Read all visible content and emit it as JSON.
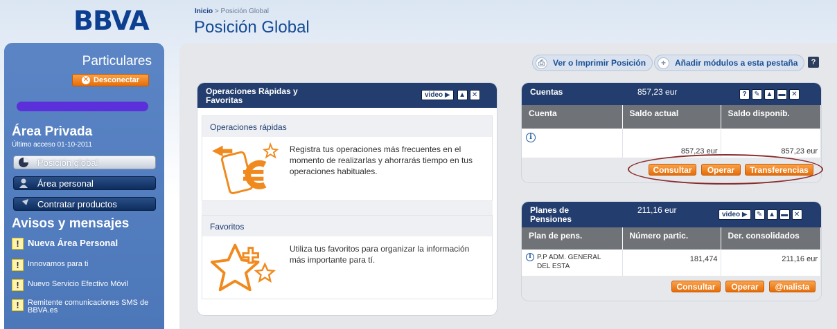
{
  "brand": {
    "logo": "BBVA",
    "accent_orange": "#e66d08",
    "navy": "#233e6e"
  },
  "header": {
    "breadcrumb_home": "Inicio",
    "breadcrumb_sep": " > ",
    "breadcrumb_current": "Posición Global",
    "title": "Posición Global"
  },
  "sidebar": {
    "title": "Particulares",
    "disconnect_label": "Desconectar",
    "area_title": "Área Privada",
    "last_access": "Último acceso  01-10-2011",
    "nav": [
      {
        "label": "Posición global",
        "icon": "pie-chart-icon",
        "active": true
      },
      {
        "label": "Área personal",
        "icon": "user-icon"
      },
      {
        "label": "Contratar productos",
        "icon": "arrow-icon"
      }
    ],
    "avisos_title": "Avisos y mensajes",
    "avisos": [
      {
        "text": "Nueva Área Personal"
      },
      {
        "text": "Innovamos para ti"
      },
      {
        "text": "Nuevo Servicio Efectivo Móvil"
      },
      {
        "text": "Remitente comunicaciones SMS de BBVA.es"
      }
    ]
  },
  "toolbar": {
    "print_label": "Ver o Imprimir Posición",
    "add_modules_label": "Añadir módulos a esta pestaña",
    "help_label": "?"
  },
  "operaciones": {
    "title": "Operaciones Rápidas y Favoritas",
    "video_label": "video",
    "rapidas_title": "Operaciones rápidas",
    "rapidas_text": "Registra tus operaciones más frecuentes en el momento de realizarlas y ahorrarás tiempo en tus operaciones habituales.",
    "favoritos_title": "Favoritos",
    "favoritos_text": "Utiliza tus favoritos para organizar la información más importante para tí."
  },
  "cuentas": {
    "title": "Cuentas",
    "total": "857,23 eur",
    "columns": [
      "Cuenta",
      "Saldo actual",
      "Saldo disponib."
    ],
    "rows": [
      {
        "saldo_actual": "857,23 eur",
        "saldo_disponible": "857,23 eur"
      }
    ],
    "buttons": [
      "Consultar",
      "Operar",
      "Transferencias"
    ]
  },
  "planes": {
    "title": "Planes de Pensiones",
    "total": "211,16 eur",
    "video_label": "video",
    "columns": [
      "Plan de pens.",
      "Número partic.",
      "Der. consolidados"
    ],
    "rows": [
      {
        "plan": "P.P ADM. GENERAL DEL ESTA",
        "participaciones": "181,474",
        "derechos": "211,16 eur"
      }
    ],
    "buttons": [
      "Consultar",
      "Operar",
      "@nalista"
    ]
  }
}
